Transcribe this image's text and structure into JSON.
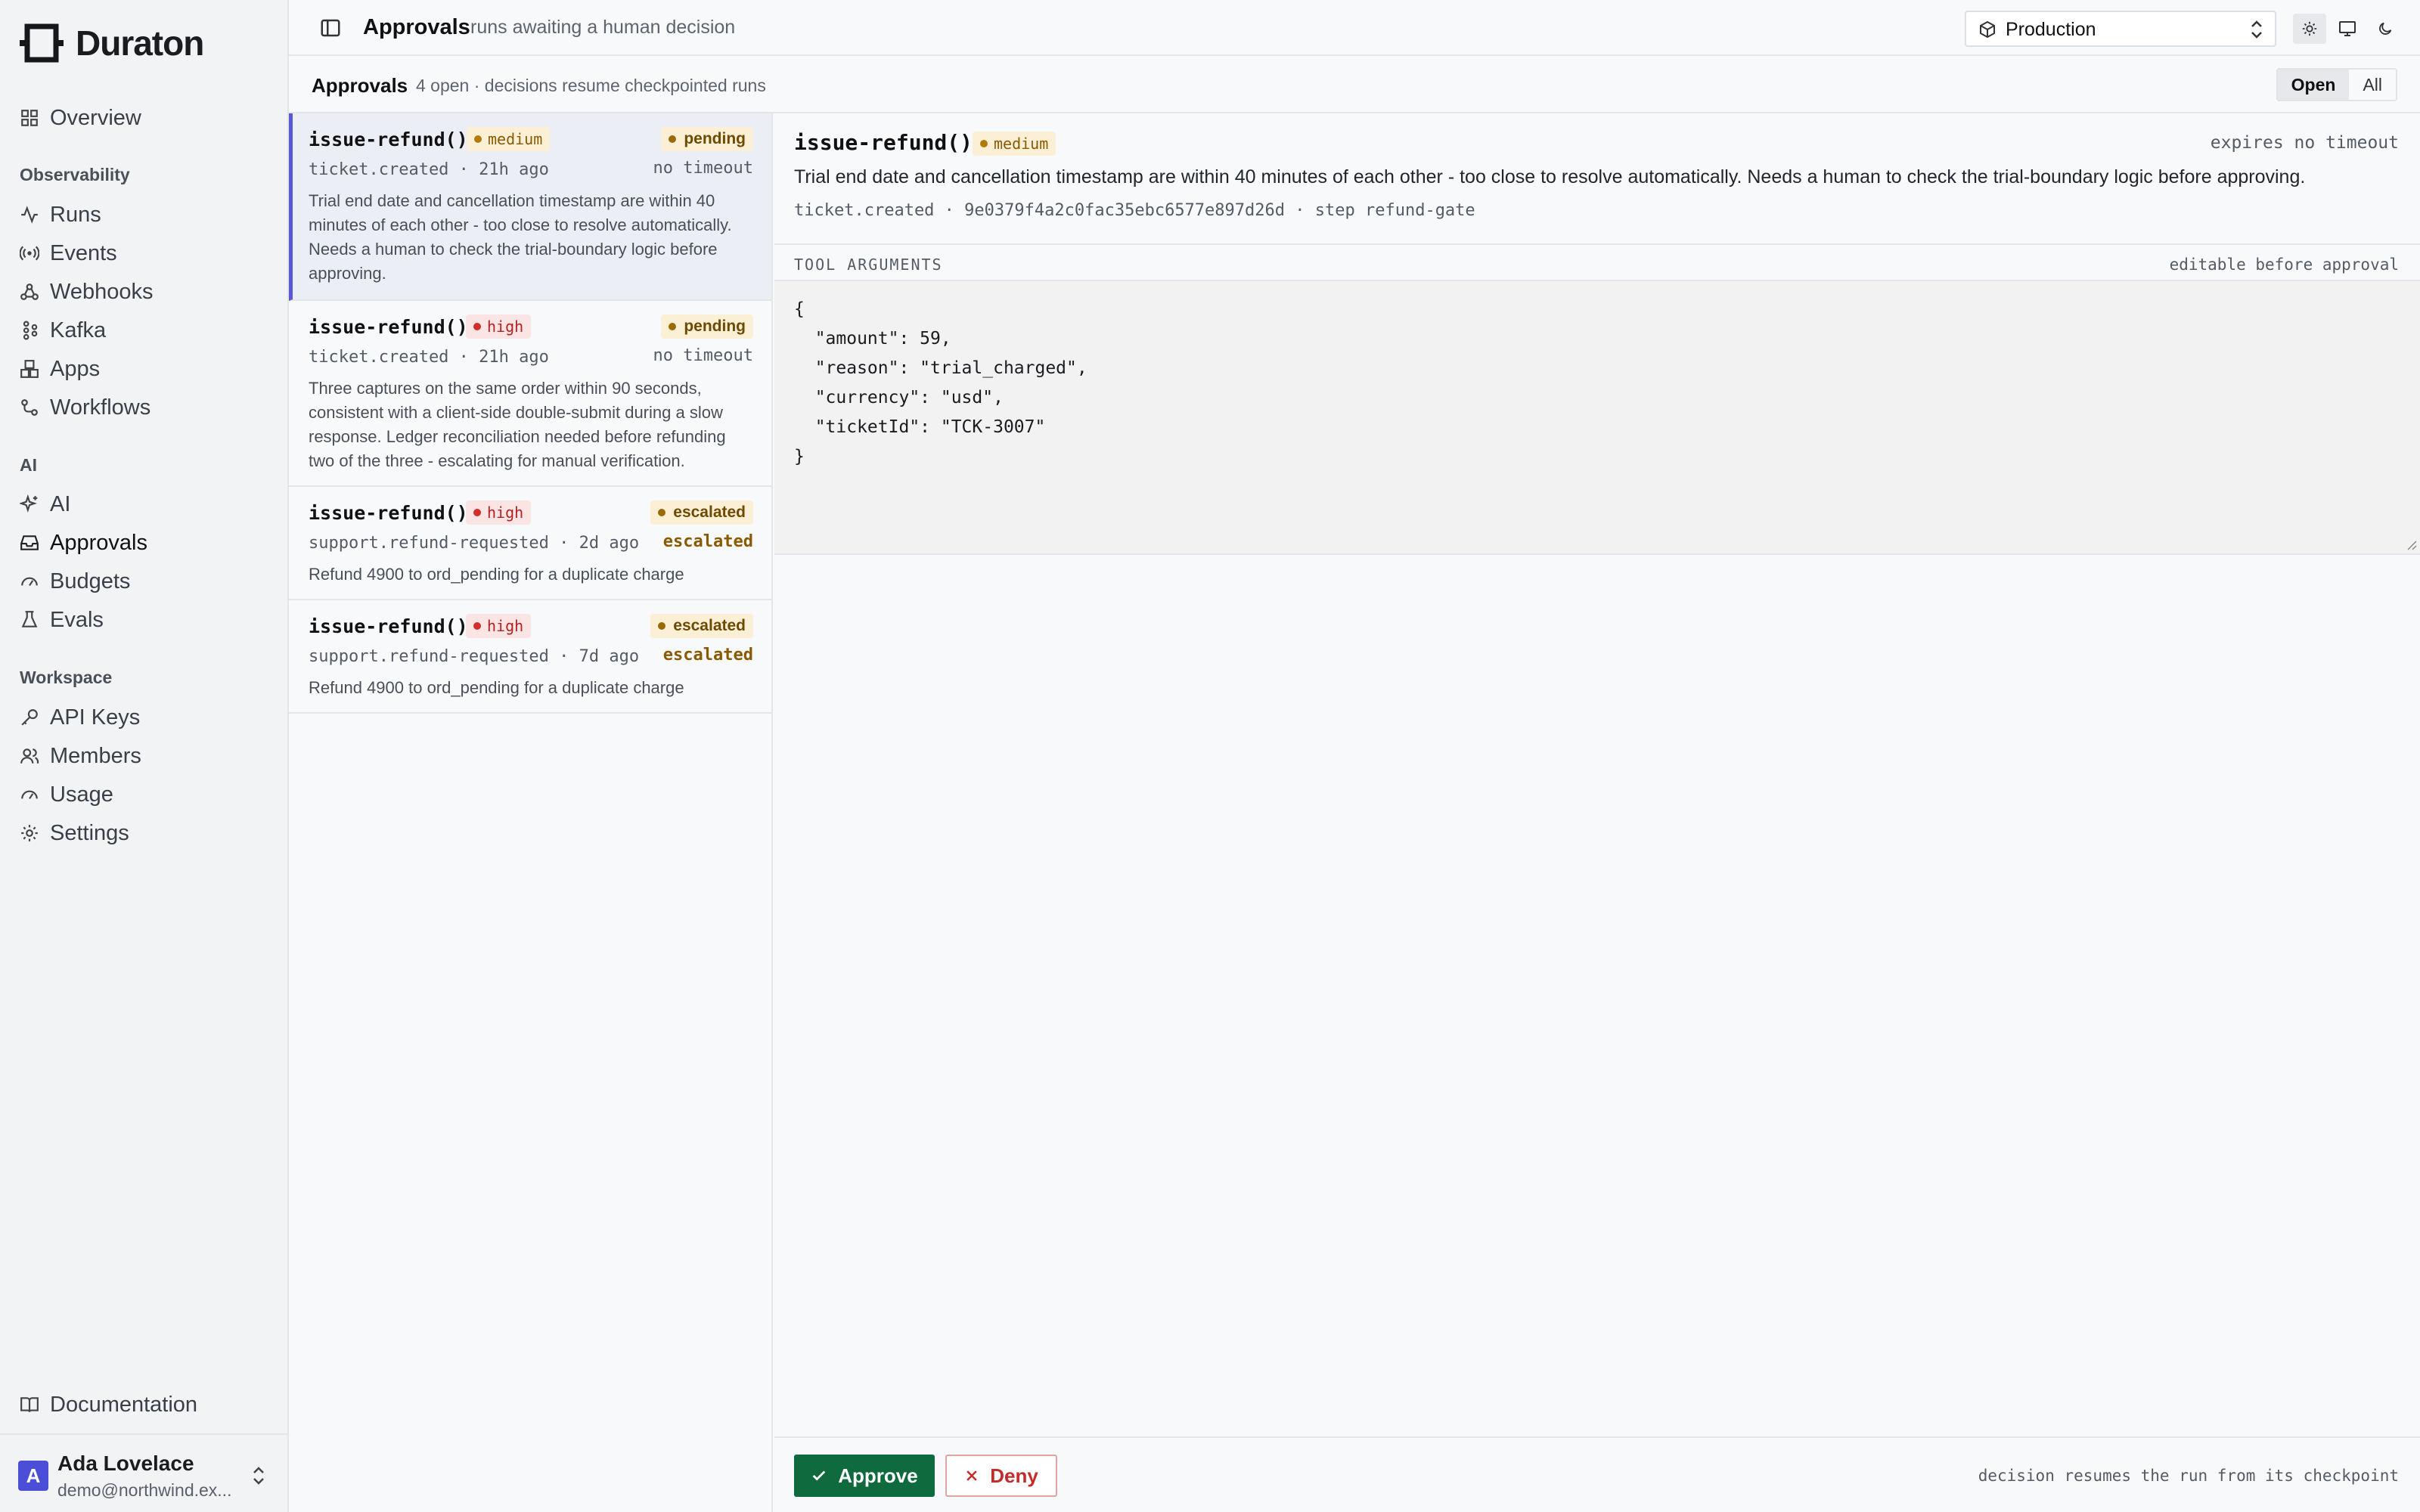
{
  "app": {
    "name": "Duraton"
  },
  "sidebar": {
    "overview": "Overview",
    "sections": {
      "observability": "Observability",
      "ai": "AI",
      "workspace": "Workspace"
    },
    "items": {
      "runs": "Runs",
      "events": "Events",
      "webhooks": "Webhooks",
      "kafka": "Kafka",
      "apps": "Apps",
      "workflows": "Workflows",
      "ai": "AI",
      "approvals": "Approvals",
      "budgets": "Budgets",
      "evals": "Evals",
      "api_keys": "API Keys",
      "members": "Members",
      "usage": "Usage",
      "settings": "Settings",
      "documentation": "Documentation"
    },
    "active": "approvals",
    "user": {
      "initial": "A",
      "name": "Ada Lovelace",
      "email": "demo@northwind.ex..."
    }
  },
  "topbar": {
    "title": "Approvals",
    "subtitle": "runs awaiting a human decision",
    "environment": "Production"
  },
  "subheader": {
    "title": "Approvals",
    "meta": "4 open · decisions resume checkpointed runs",
    "filters": [
      "Open",
      "All"
    ],
    "active_filter": "Open"
  },
  "approvals": [
    {
      "fn": "issue-refund()",
      "severity": "medium",
      "status": "pending",
      "meta": "ticket.created · 21h ago",
      "right": "no timeout",
      "desc": "Trial end date and cancellation timestamp are within 40 minutes of each other - too close to resolve automatically. Needs a human to check the trial-boundary logic before approving."
    },
    {
      "fn": "issue-refund()",
      "severity": "high",
      "status": "pending",
      "meta": "ticket.created · 21h ago",
      "right": "no timeout",
      "desc": "Three captures on the same order within 90 seconds, consistent with a client-side double-submit during a slow response. Ledger reconciliation needed before refunding two of the three - escalating for manual verification."
    },
    {
      "fn": "issue-refund()",
      "severity": "high",
      "status": "escalated",
      "meta": "support.refund-requested · 2d ago",
      "right": "escalated",
      "desc": "Refund 4900 to ord_pending for a duplicate charge"
    },
    {
      "fn": "issue-refund()",
      "severity": "high",
      "status": "escalated",
      "meta": "support.refund-requested · 7d ago",
      "right": "escalated",
      "desc": "Refund 4900 to ord_pending for a duplicate charge"
    }
  ],
  "detail": {
    "fn": "issue-refund()",
    "severity": "medium",
    "expires": "expires no timeout",
    "desc": "Trial end date and cancellation timestamp are within 40 minutes of each other - too close to resolve automatically. Needs a human to check the trial-boundary logic before approving.",
    "meta": "ticket.created · 9e0379f4a2c0fac35ebc6577e897d26d · step refund-gate",
    "args_label": "TOOL ARGUMENTS",
    "args_note": "editable before approval",
    "args_lines": [
      "{",
      "  \"amount\": 59,",
      "  \"reason\": \"trial_charged\",",
      "  \"currency\": \"usd\",",
      "  \"ticketId\": \"TCK-3007\"",
      "}"
    ],
    "approve_label": "Approve",
    "deny_label": "Deny",
    "footer_note": "decision resumes the run from its checkpoint"
  },
  "colors": {
    "accent": "#5658d6",
    "approve": "#0f6b3d",
    "deny": "#c42b2b",
    "medium_bg": "#fbf0d6",
    "high_bg": "#fbe4e4"
  }
}
